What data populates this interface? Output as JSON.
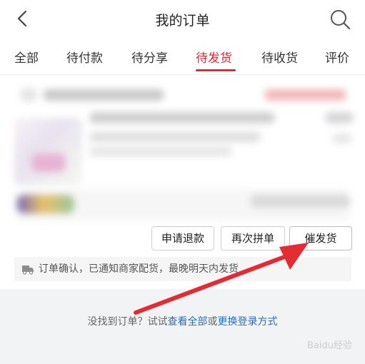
{
  "header": {
    "title": "我的订单",
    "back_icon": "chevron-left-icon",
    "search_icon": "search-icon"
  },
  "tabs": [
    {
      "label": "全部",
      "active": false
    },
    {
      "label": "待付款",
      "active": false
    },
    {
      "label": "待分享",
      "active": false
    },
    {
      "label": "待发货",
      "active": true
    },
    {
      "label": "待收货",
      "active": false
    },
    {
      "label": "评价",
      "active": false
    }
  ],
  "order_actions": {
    "refund_label": "申请退款",
    "regroup_label": "再次拼单",
    "urge_label": "催发货"
  },
  "notice": {
    "icon": "truck-icon",
    "text": "订单确认，已通知商家配货，最晚明天内发货"
  },
  "empty_tip": {
    "prefix": "没找到订单？试试",
    "view_all": "查看全部",
    "or": "或",
    "switch_login": "更换登录方式"
  },
  "watermark": {
    "text": "Baidu经验"
  },
  "colors": {
    "accent": "#e8262f",
    "link": "#1d6fd1",
    "arrow": "#e32b34"
  }
}
